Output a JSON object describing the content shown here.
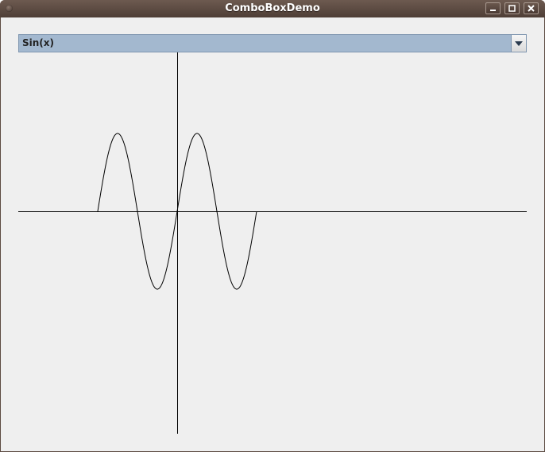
{
  "window": {
    "title": "ComboBoxDemo"
  },
  "combo": {
    "selected": "Sin(x)"
  },
  "icons": {
    "window_menu": "window-menu-icon",
    "minimize": "minimize-icon",
    "maximize": "maximize-icon",
    "close": "close-icon",
    "dropdown": "chevron-down-icon"
  },
  "colors": {
    "titlebar": "#5c4b42",
    "combo_selection": "#a3b8cf",
    "panel_background": "#efefef",
    "plot_stroke": "#000000"
  },
  "chart_data": {
    "type": "line",
    "function": "sin(x)",
    "xlim": [
      -6.283,
      6.283
    ],
    "ylim": [
      -1,
      1
    ],
    "series": [
      {
        "x": [
          -6.283,
          -5.498,
          -4.712,
          -3.927,
          -3.142,
          -2.356,
          -1.571,
          -0.785,
          0,
          0.785,
          1.571,
          2.356,
          3.142,
          3.927,
          4.712,
          5.498,
          6.283
        ],
        "values": [
          0,
          0.707,
          1,
          0.707,
          0,
          -0.707,
          -1,
          -0.707,
          0,
          0.707,
          1,
          0.707,
          0,
          -0.707,
          -1,
          -0.707,
          0
        ]
      }
    ]
  }
}
